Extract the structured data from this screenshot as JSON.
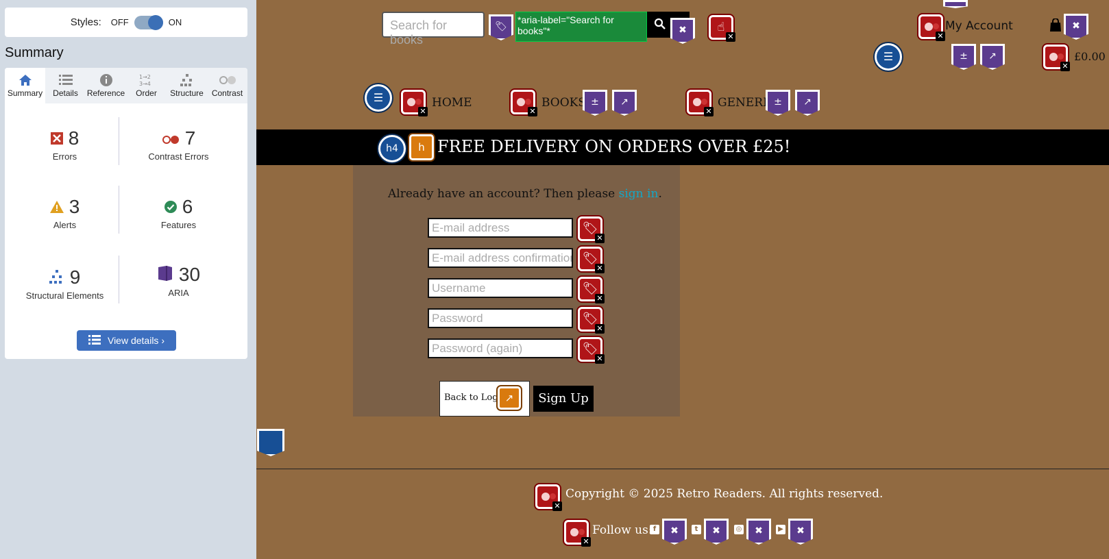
{
  "sidebar": {
    "styles_label": "Styles:",
    "off_label": "OFF",
    "on_label": "ON",
    "summary_heading": "Summary",
    "tabs": [
      {
        "label": "Summary",
        "icon": "home-icon"
      },
      {
        "label": "Details",
        "icon": "list-icon"
      },
      {
        "label": "Reference",
        "icon": "info-icon"
      },
      {
        "label": "Order",
        "icon": "order-icon"
      },
      {
        "label": "Structure",
        "icon": "structure-icon"
      },
      {
        "label": "Contrast",
        "icon": "contrast-icon"
      }
    ],
    "stats": {
      "errors": {
        "value": "8",
        "label": "Errors"
      },
      "contrast_errors": {
        "value": "7",
        "label": "Contrast Errors"
      },
      "alerts": {
        "value": "3",
        "label": "Alerts"
      },
      "features": {
        "value": "6",
        "label": "Features"
      },
      "structural": {
        "value": "9",
        "label": "Structural Elements"
      },
      "aria": {
        "value": "30",
        "label": "ARIA"
      }
    },
    "view_details": "View details ›",
    "colors": {
      "accent": "#3d6fbf",
      "error": "#c0392b",
      "alert": "#e0a020",
      "feature": "#2e8b57",
      "aria": "#5b3b8e"
    }
  },
  "header": {
    "search_placeholder": "Search for books",
    "aria_tooltip": "*aria-label=\"Search for books\"*",
    "my_account": "My Account",
    "cart_total": "£0.00"
  },
  "nav": {
    "home": "HOME",
    "books": "BOOKS",
    "genre": "GENERE"
  },
  "banner": {
    "heading_badge": "h4",
    "text": "FREE DELIVERY ON ORDERS OVER £25!"
  },
  "form": {
    "account_prefix": "Already have an account? Then please ",
    "sign_in": "sign in",
    "account_suffix": ".",
    "fields": [
      "E-mail address",
      "E-mail address confirmation",
      "Username",
      "Password",
      "Password (again)"
    ],
    "back_to_login": "Back to Login",
    "sign_up": "Sign Up"
  },
  "footer": {
    "copyright": "Copyright © 2025 Retro Readers. All rights reserved.",
    "follow_us": "Follow us:"
  }
}
